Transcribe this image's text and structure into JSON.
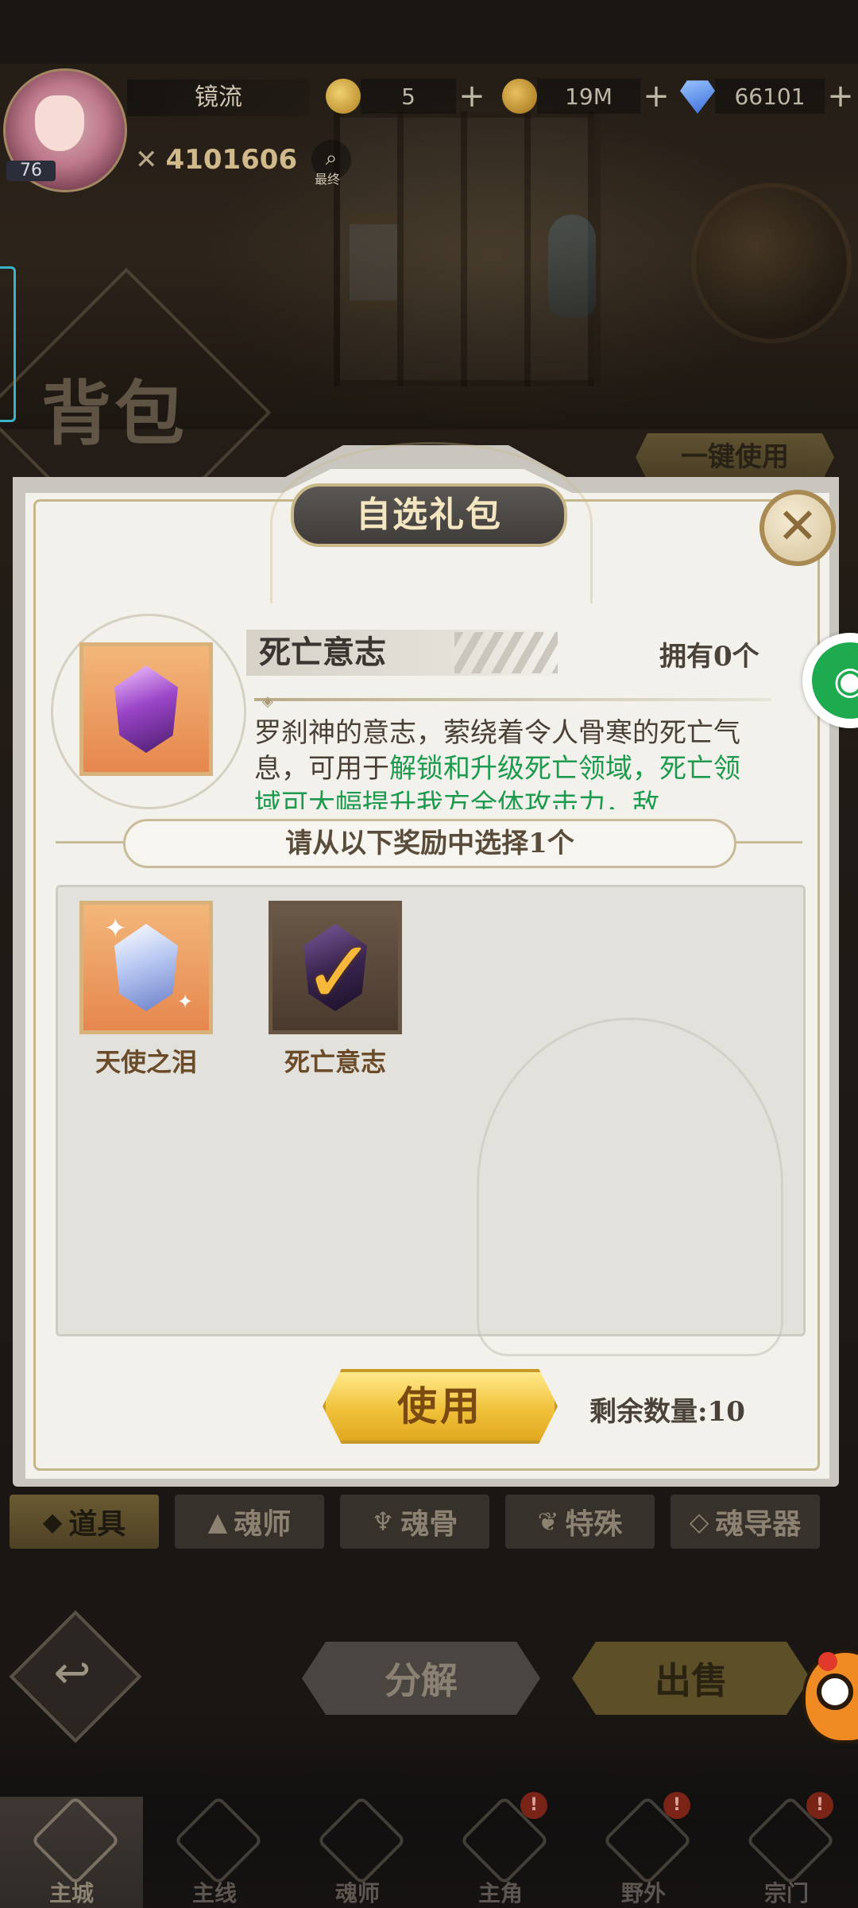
{
  "player": {
    "name": "镜流",
    "level": "76",
    "power": "4101606",
    "search_tag": "最终"
  },
  "resources": [
    {
      "icon": "gold-coin-icon",
      "value": "5"
    },
    {
      "icon": "copper-coin-icon",
      "value": "19M"
    },
    {
      "icon": "diamond-icon",
      "value": "66101"
    }
  ],
  "background": {
    "bag_title": "背包",
    "one_key_use": "一键使用"
  },
  "dialog": {
    "title": "自选礼包",
    "item": {
      "name": "死亡意志",
      "owned": "拥有0个",
      "desc_plain": "罗刹神的意志，萦绕着令人骨寒的死亡气息，可用于",
      "desc_highlight": "解锁和升级死亡领域，死亡领域可大幅提升我方全体攻击力，敌"
    },
    "select_prompt": "请从以下奖励中选择1个",
    "rewards": [
      {
        "label": "天使之泪",
        "icon": "angel-tear-icon",
        "selected": false
      },
      {
        "label": "死亡意志",
        "icon": "death-will-icon",
        "selected": true
      }
    ],
    "use_button": "使用",
    "remaining": "剩余数量:10"
  },
  "category_tabs": [
    {
      "label": "道具",
      "icon": "item-icon",
      "active": true
    },
    {
      "label": "魂师",
      "icon": "soul-master-icon",
      "active": false
    },
    {
      "label": "魂骨",
      "icon": "soul-bone-icon",
      "active": false
    },
    {
      "label": "特殊",
      "icon": "special-icon",
      "active": false
    },
    {
      "label": "魂导器",
      "icon": "soul-device-icon",
      "active": false
    }
  ],
  "actions": {
    "decompose": "分解",
    "sell": "出售"
  },
  "nav": [
    {
      "label": "主城",
      "active": true,
      "badge": ""
    },
    {
      "label": "主线",
      "active": false,
      "badge": ""
    },
    {
      "label": "魂师",
      "active": false,
      "badge": ""
    },
    {
      "label": "主角",
      "active": false,
      "badge": "!"
    },
    {
      "label": "野外",
      "active": false,
      "badge": "!"
    },
    {
      "label": "宗门",
      "active": false,
      "badge": "!"
    }
  ],
  "colors": {
    "highlight_text": "#1e9a4e",
    "use_button": "#f0c23a",
    "reward_label": "#6a4b2a"
  }
}
